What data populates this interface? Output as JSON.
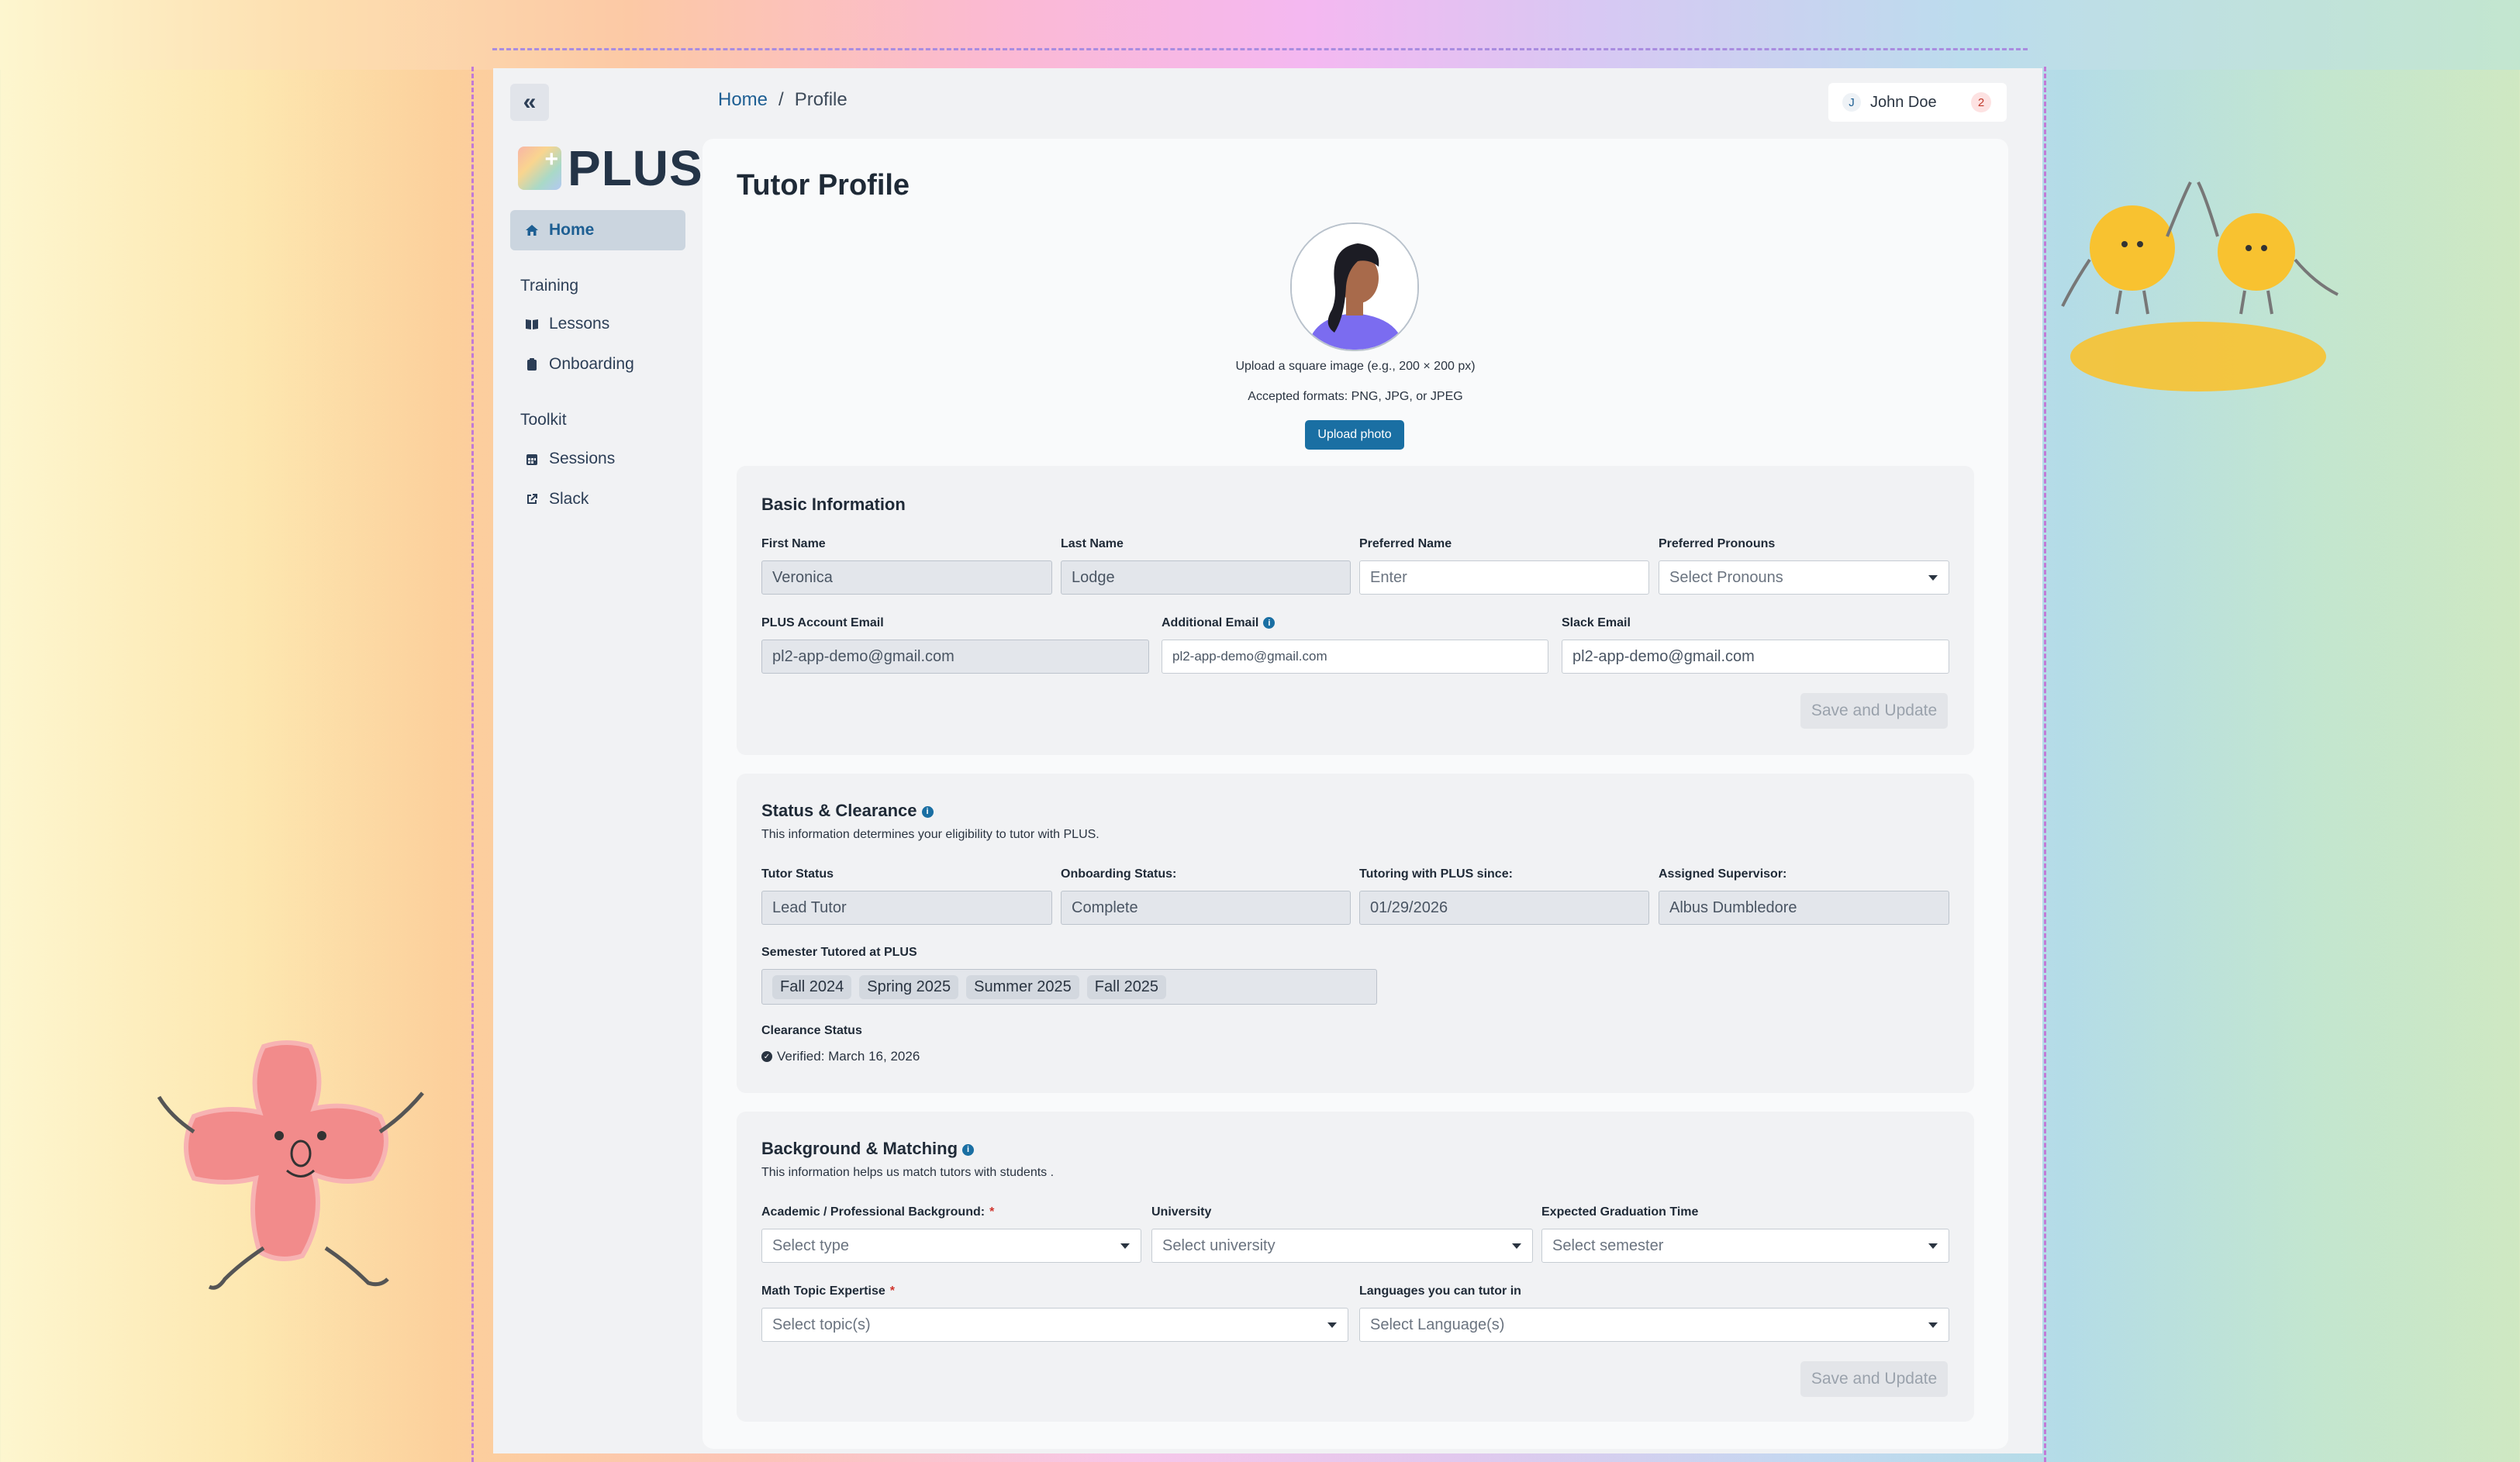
{
  "sidebar": {
    "collapse_icon": "chevrons-left-icon",
    "logo_text": "PLUS",
    "items": [
      {
        "label": "Home",
        "icon": "home-icon",
        "active": true
      },
      {
        "label": "Lessons",
        "icon": "book-icon"
      },
      {
        "label": "Onboarding",
        "icon": "clipboard-icon"
      },
      {
        "label": "Sessions",
        "icon": "calendar-icon"
      },
      {
        "label": "Slack",
        "icon": "external-link-icon"
      }
    ],
    "sections": [
      "Training",
      "Toolkit"
    ]
  },
  "header": {
    "breadcrumb": [
      "Home",
      "/",
      "Profile"
    ],
    "user_initial": "J",
    "user_name": "John Doe",
    "notification_count": "2"
  },
  "page": {
    "title": "Tutor Profile",
    "upload_note_1": "Upload a square image (e.g., 200 × 200 px)",
    "upload_note_2": "Accepted formats: PNG, JPG, or JPEG",
    "upload_button": "Upload photo"
  },
  "basic": {
    "title": "Basic Information",
    "first_name_label": "First Name",
    "first_name": "Veronica",
    "last_name_label": "Last Name",
    "last_name": "Lodge",
    "preferred_name_label": "Preferred Name",
    "preferred_name_placeholder": "Enter",
    "pronouns_label": "Preferred Pronouns",
    "pronouns_placeholder": "Select Pronouns",
    "plus_email_label": "PLUS Account Email",
    "plus_email": "pl2-app-demo@gmail.com",
    "additional_email_label": "Additional Email",
    "additional_email": "pl2-app-demo@gmail.com",
    "slack_email_label": "Slack Email",
    "slack_email": "pl2-app-demo@gmail.com",
    "save_button": "Save and Update"
  },
  "status": {
    "title": "Status & Clearance",
    "subtitle": "This information determines your eligibility to tutor with PLUS.",
    "tutor_status_label": "Tutor Status",
    "tutor_status": "Lead Tutor",
    "onboarding_label": "Onboarding Status:",
    "onboarding": "Complete",
    "since_label": "Tutoring with PLUS since:",
    "since": "01/29/2026",
    "supervisor_label": "Assigned Supervisor:",
    "supervisor": "Albus Dumbledore",
    "semesters_label": "Semester Tutored at PLUS",
    "semesters": [
      "Fall 2024",
      "Spring 2025",
      "Summer 2025",
      "Fall 2025"
    ],
    "clearance_label": "Clearance Status",
    "clearance": "Verified: March 16, 2026"
  },
  "background": {
    "title": "Background & Matching",
    "subtitle": "This information helps us match tutors with students .",
    "academic_label": "Academic / Professional Background:",
    "academic_placeholder": "Select type",
    "university_label": "University",
    "university_placeholder": "Select university",
    "graduation_label": "Expected Graduation Time",
    "graduation_placeholder": "Select semester",
    "math_label": "Math Topic Expertise",
    "math_placeholder": "Select topic(s)",
    "languages_label": "Languages you can tutor in",
    "languages_placeholder": "Select Language(s)",
    "save_button": "Save and Update"
  },
  "colors": {
    "accent": "#1a6fa3",
    "nav_active": "#cbd5df",
    "required": "#d0342c"
  }
}
